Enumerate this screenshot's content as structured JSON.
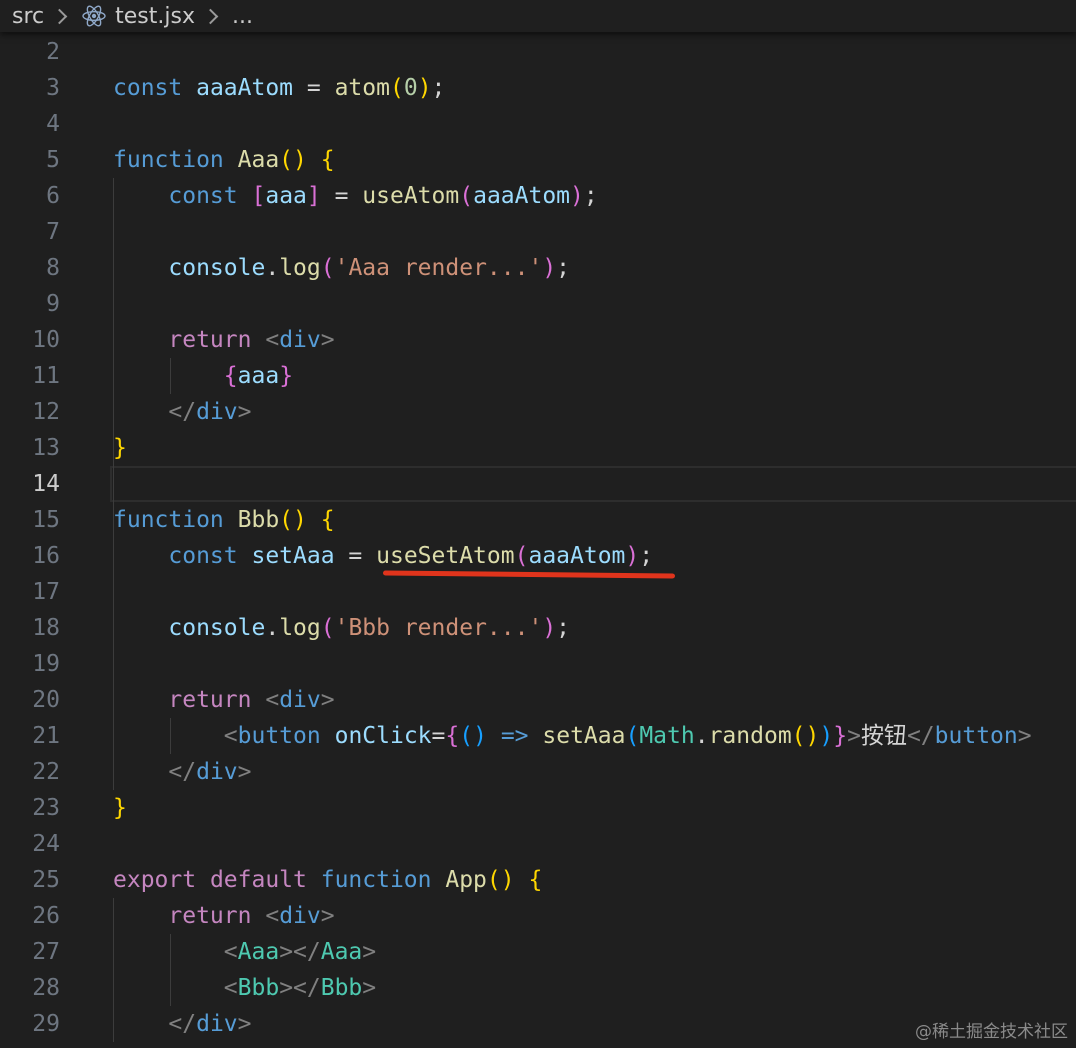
{
  "breadcrumb": {
    "folder": "src",
    "file": "test.jsx",
    "more": "..."
  },
  "editor": {
    "current_line": 14,
    "lines": [
      {
        "n": "2",
        "tokens": []
      },
      {
        "n": "3",
        "tokens": [
          [
            "kw",
            "const "
          ],
          [
            "var",
            "aaaAtom"
          ],
          [
            "op",
            " = "
          ],
          [
            "fn",
            "atom"
          ],
          [
            "b1",
            "("
          ],
          [
            "num",
            "0"
          ],
          [
            "b1",
            ")"
          ],
          [
            "op",
            ";"
          ]
        ]
      },
      {
        "n": "4",
        "tokens": []
      },
      {
        "n": "5",
        "tokens": [
          [
            "kw",
            "function "
          ],
          [
            "fn",
            "Aaa"
          ],
          [
            "b1",
            "()"
          ],
          [
            "op",
            " "
          ],
          [
            "b1",
            "{"
          ]
        ]
      },
      {
        "n": "6",
        "tokens": [
          [
            "op",
            "    "
          ],
          [
            "kw",
            "const "
          ],
          [
            "b2",
            "["
          ],
          [
            "var",
            "aaa"
          ],
          [
            "b2",
            "]"
          ],
          [
            "op",
            " = "
          ],
          [
            "fn",
            "useAtom"
          ],
          [
            "b2",
            "("
          ],
          [
            "var",
            "aaaAtom"
          ],
          [
            "b2",
            ")"
          ],
          [
            "op",
            ";"
          ]
        ]
      },
      {
        "n": "7",
        "tokens": []
      },
      {
        "n": "8",
        "tokens": [
          [
            "op",
            "    "
          ],
          [
            "obj",
            "console"
          ],
          [
            "op",
            "."
          ],
          [
            "fn",
            "log"
          ],
          [
            "b2",
            "("
          ],
          [
            "str",
            "'Aaa render...'"
          ],
          [
            "b2",
            ")"
          ],
          [
            "op",
            ";"
          ]
        ]
      },
      {
        "n": "9",
        "tokens": []
      },
      {
        "n": "10",
        "tokens": [
          [
            "op",
            "    "
          ],
          [
            "ctl",
            "return "
          ],
          [
            "punct",
            "<"
          ],
          [
            "tag",
            "div"
          ],
          [
            "punct",
            ">"
          ]
        ]
      },
      {
        "n": "11",
        "tokens": [
          [
            "op",
            "        "
          ],
          [
            "b2",
            "{"
          ],
          [
            "var",
            "aaa"
          ],
          [
            "b2",
            "}"
          ]
        ]
      },
      {
        "n": "12",
        "tokens": [
          [
            "op",
            "    "
          ],
          [
            "punct",
            "</"
          ],
          [
            "tag",
            "div"
          ],
          [
            "punct",
            ">"
          ]
        ]
      },
      {
        "n": "13",
        "tokens": [
          [
            "b1",
            "}"
          ]
        ]
      },
      {
        "n": "14",
        "tokens": []
      },
      {
        "n": "15",
        "tokens": [
          [
            "kw",
            "function "
          ],
          [
            "fn",
            "Bbb"
          ],
          [
            "b1",
            "()"
          ],
          [
            "op",
            " "
          ],
          [
            "b1",
            "{"
          ]
        ]
      },
      {
        "n": "16",
        "tokens": [
          [
            "op",
            "    "
          ],
          [
            "kw",
            "const "
          ],
          [
            "var",
            "setAaa"
          ],
          [
            "op",
            " = "
          ],
          [
            "fn",
            "useSetAtom"
          ],
          [
            "b2",
            "("
          ],
          [
            "var",
            "aaaAtom"
          ],
          [
            "b2",
            ")"
          ],
          [
            "op",
            ";"
          ]
        ]
      },
      {
        "n": "17",
        "tokens": []
      },
      {
        "n": "18",
        "tokens": [
          [
            "op",
            "    "
          ],
          [
            "obj",
            "console"
          ],
          [
            "op",
            "."
          ],
          [
            "fn",
            "log"
          ],
          [
            "b2",
            "("
          ],
          [
            "str",
            "'Bbb render...'"
          ],
          [
            "b2",
            ")"
          ],
          [
            "op",
            ";"
          ]
        ]
      },
      {
        "n": "19",
        "tokens": []
      },
      {
        "n": "20",
        "tokens": [
          [
            "op",
            "    "
          ],
          [
            "ctl",
            "return "
          ],
          [
            "punct",
            "<"
          ],
          [
            "tag",
            "div"
          ],
          [
            "punct",
            ">"
          ]
        ]
      },
      {
        "n": "21",
        "tokens": [
          [
            "op",
            "        "
          ],
          [
            "punct",
            "<"
          ],
          [
            "tag",
            "button"
          ],
          [
            "op",
            " "
          ],
          [
            "var",
            "onClick"
          ],
          [
            "op",
            "="
          ],
          [
            "b2",
            "{"
          ],
          [
            "b3",
            "()"
          ],
          [
            "op",
            " "
          ],
          [
            "kw",
            "=>"
          ],
          [
            "op",
            " "
          ],
          [
            "fn",
            "setAaa"
          ],
          [
            "b3",
            "("
          ],
          [
            "comp",
            "Math"
          ],
          [
            "op",
            "."
          ],
          [
            "fn",
            "random"
          ],
          [
            "b1",
            "()"
          ],
          [
            "b3",
            ")"
          ],
          [
            "b2",
            "}"
          ],
          [
            "punct",
            ">"
          ],
          [
            "txt",
            "按钮"
          ],
          [
            "punct",
            "</"
          ],
          [
            "tag",
            "button"
          ],
          [
            "punct",
            ">"
          ]
        ]
      },
      {
        "n": "22",
        "tokens": [
          [
            "op",
            "    "
          ],
          [
            "punct",
            "</"
          ],
          [
            "tag",
            "div"
          ],
          [
            "punct",
            ">"
          ]
        ]
      },
      {
        "n": "23",
        "tokens": [
          [
            "b1",
            "}"
          ]
        ]
      },
      {
        "n": "24",
        "tokens": []
      },
      {
        "n": "25",
        "tokens": [
          [
            "ctl",
            "export "
          ],
          [
            "ctl",
            "default "
          ],
          [
            "kw",
            "function "
          ],
          [
            "fn",
            "App"
          ],
          [
            "b1",
            "()"
          ],
          [
            "op",
            " "
          ],
          [
            "b1",
            "{"
          ]
        ]
      },
      {
        "n": "26",
        "tokens": [
          [
            "op",
            "    "
          ],
          [
            "ctl",
            "return "
          ],
          [
            "punct",
            "<"
          ],
          [
            "tag",
            "div"
          ],
          [
            "punct",
            ">"
          ]
        ]
      },
      {
        "n": "27",
        "tokens": [
          [
            "op",
            "        "
          ],
          [
            "punct",
            "<"
          ],
          [
            "comp",
            "Aaa"
          ],
          [
            "punct",
            "></"
          ],
          [
            "comp",
            "Aaa"
          ],
          [
            "punct",
            ">"
          ]
        ]
      },
      {
        "n": "28",
        "tokens": [
          [
            "op",
            "        "
          ],
          [
            "punct",
            "<"
          ],
          [
            "comp",
            "Bbb"
          ],
          [
            "punct",
            "></"
          ],
          [
            "comp",
            "Bbb"
          ],
          [
            "punct",
            ">"
          ]
        ]
      },
      {
        "n": "29",
        "tokens": [
          [
            "op",
            "    "
          ],
          [
            "punct",
            "</"
          ],
          [
            "tag",
            "div"
          ],
          [
            "punct",
            ">"
          ]
        ]
      }
    ]
  },
  "annotation": {
    "underline_color": "#e0341c",
    "target_text": "useSetAtom(aaaAtom)"
  },
  "watermark": "@稀土掘金技术社区"
}
